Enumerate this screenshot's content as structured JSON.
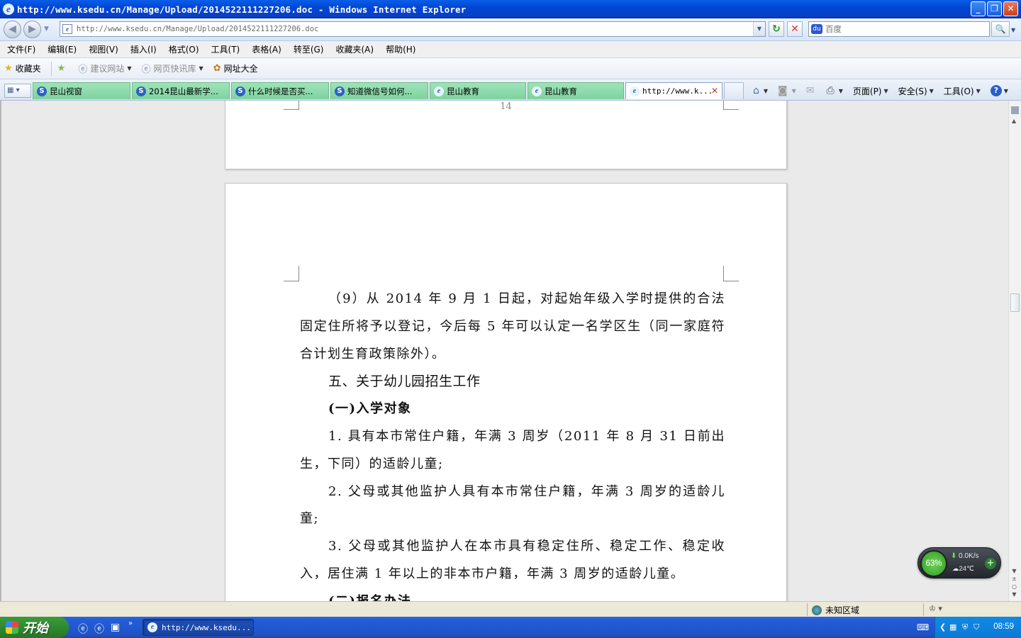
{
  "window": {
    "title": "http://www.ksedu.cn/Manage/Upload/2014522111227206.doc - Windows Internet Explorer",
    "controls": [
      "_",
      "❐",
      "✕"
    ]
  },
  "address_bar": {
    "url": "http://www.ksedu.cn/Manage/Upload/2014522111227206.doc",
    "search_placeholder": "百度"
  },
  "menu": [
    "文件(F)",
    "编辑(E)",
    "视图(V)",
    "插入(I)",
    "格式(O)",
    "工具(T)",
    "表格(A)",
    "转至(G)",
    "收藏夹(A)",
    "帮助(H)"
  ],
  "favorites_bar": {
    "favorites": "收藏夹",
    "suggested_sites": "建议网站",
    "web_slice": "网页快讯库",
    "url_directory": "网址大全"
  },
  "tabs": [
    {
      "label": "昆山视窗",
      "icon": "s"
    },
    {
      "label": "2014昆山最新学...",
      "icon": "s"
    },
    {
      "label": "什么时候是否买...",
      "icon": "s"
    },
    {
      "label": "知道微信号如何...",
      "icon": "s"
    },
    {
      "label": "昆山教育",
      "icon": "e"
    },
    {
      "label": "昆山教育",
      "icon": "e"
    },
    {
      "label": "http://www.k...",
      "icon": "e",
      "active": true
    }
  ],
  "command_bar": {
    "page": "页面(P)",
    "safety": "安全(S)",
    "tools": "工具(O)"
  },
  "document": {
    "prev_page_number": "14",
    "paragraphs": [
      {
        "style": "ind",
        "text": "（9）从 2014 年 9 月 1 日起，对起始年级入学时提供的合法固定住所将予以登记，今后每 5 年可以认定一名学区生（同一家庭符合计划生育政策除外）。"
      },
      {
        "style": "h",
        "text": "五、关于幼儿园招生工作"
      },
      {
        "style": "hb",
        "text": "(一)入学对象"
      },
      {
        "style": "ind",
        "text": "1. 具有本市常住户籍，年满 3 周岁（2011 年 8 月 31 日前出生，下同）的适龄儿童;"
      },
      {
        "style": "ind",
        "text": "2. 父母或其他监护人具有本市常住户籍，年满 3 周岁的适龄儿童;"
      },
      {
        "style": "ind",
        "text": "3. 父母或其他监护人在本市具有稳定住所、稳定工作、稳定收入，居住满 1 年以上的非本市户籍，年满 3 周岁的适龄儿童。"
      },
      {
        "style": "hb",
        "text": "(二)报名办法"
      }
    ]
  },
  "net_widget": {
    "percent": "63%",
    "speed": "0.0K/s",
    "temperature": "24℃"
  },
  "status_bar": {
    "zone": "未知区域"
  },
  "taskbar": {
    "start": "开始",
    "task": "http://www.ksedu...",
    "clock": "08:59"
  }
}
